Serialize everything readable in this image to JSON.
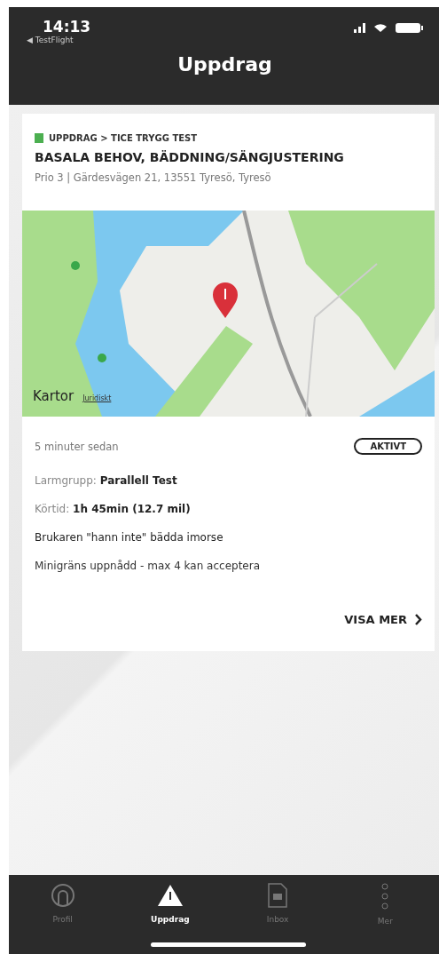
{
  "status_bar": {
    "time": "14:13",
    "back_label": "◀ TestFlight"
  },
  "header": {
    "title": "Uppdrag"
  },
  "card": {
    "breadcrumb": "UPPDRAG > TICE TRYGG TEST",
    "title": "BASALA BEHOV, BÄDDNING/SÄNGJUSTERING",
    "subtitle": "Prio 3 | Gärdesvägen 21, 13551 Tyresö, Tyresö",
    "map": {
      "brand": "Kartor",
      "legal": "Juridiskt"
    },
    "time_ago": "5 minuter sedan",
    "status": "AKTIVT",
    "details": [
      {
        "label": "Larmgrupp: ",
        "value": "Parallell Test",
        "kind": "labeled"
      },
      {
        "label": "Körtid: ",
        "value": "1h 45min (12.7 mil)",
        "kind": "labeled"
      },
      {
        "text": "Brukaren \"hann inte\" bädda imorse",
        "kind": "note"
      },
      {
        "text": "Minigräns uppnådd - max 4 kan acceptera",
        "kind": "plain"
      }
    ],
    "more": "VISA MER"
  },
  "tabs": [
    {
      "label": "Profil",
      "kind": "profile",
      "selected": false
    },
    {
      "label": "Uppdrag",
      "kind": "assignments",
      "selected": true
    },
    {
      "label": "Inbox",
      "kind": "inbox",
      "selected": false
    },
    {
      "label": "Mer",
      "kind": "more",
      "selected": false
    }
  ]
}
